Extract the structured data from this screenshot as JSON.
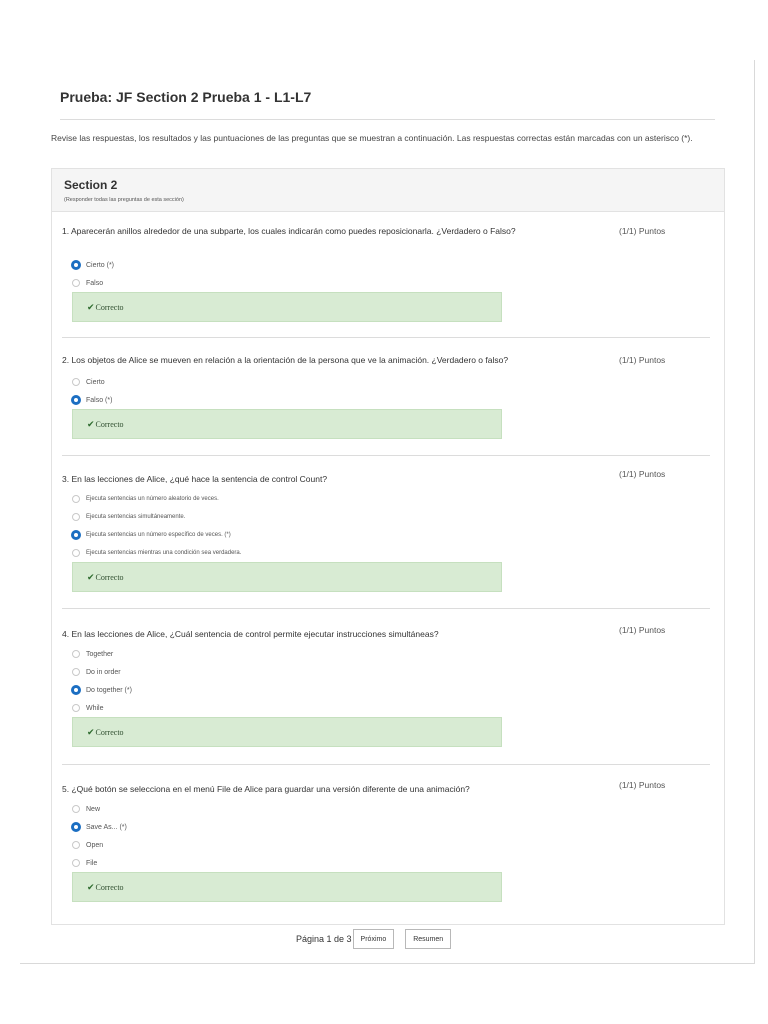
{
  "quiz": {
    "title": "Prueba: JF Section 2 Prueba 1 - L1-L7",
    "intro": "Revise las respuestas, los resultados y las puntuaciones de las preguntas que se muestran a continuación. Las respuestas correctas están marcadas con un asterisco (*)."
  },
  "section": {
    "title": "Section 2",
    "subtitle": "(Responder todas las preguntas de esta sección)"
  },
  "questions": [
    {
      "text": "1. Aparecerán anillos alrededor de una subparte, los cuales indicarán como puedes reposicionarla. ¿Verdadero o Falso?",
      "points": "(1/1) Puntos",
      "options": [
        {
          "label": "Cierto (*)",
          "selected": true
        },
        {
          "label": "Falso",
          "selected": false
        }
      ],
      "feedback": "Correcto"
    },
    {
      "text": "2. Los objetos de Alice se mueven en relación a la orientación de la persona que ve la animación. ¿Verdadero o falso?",
      "points": "(1/1) Puntos",
      "options": [
        {
          "label": "Cierto",
          "selected": false
        },
        {
          "label": "Falso (*)",
          "selected": true
        }
      ],
      "feedback": "Correcto"
    },
    {
      "text": "3. En las lecciones de Alice, ¿qué hace la sentencia de control Count?",
      "points": "(1/1) Puntos",
      "options": [
        {
          "label": "Ejecuta sentencias un número aleatorio de veces.",
          "selected": false
        },
        {
          "label": "Ejecuta sentencias simultáneamente.",
          "selected": false
        },
        {
          "label": "Ejecuta sentencias un número específico de veces. (*)",
          "selected": true
        },
        {
          "label": "Ejecuta sentencias mientras una condición sea verdadera.",
          "selected": false
        }
      ],
      "feedback": "Correcto"
    },
    {
      "text": "4. En las lecciones de Alice, ¿Cuál sentencia de control permite ejecutar instrucciones simultáneas?",
      "points": "(1/1) Puntos",
      "options": [
        {
          "label": "Together",
          "selected": false
        },
        {
          "label": "Do in order",
          "selected": false
        },
        {
          "label": "Do together (*)",
          "selected": true
        },
        {
          "label": "While",
          "selected": false
        }
      ],
      "feedback": "Correcto"
    },
    {
      "text": "5. ¿Qué botón se selecciona en el menú File de Alice para guardar una versión diferente de una animación?",
      "points": "(1/1) Puntos",
      "options": [
        {
          "label": "New",
          "selected": false
        },
        {
          "label": "Save As... (*)",
          "selected": true
        },
        {
          "label": "Open",
          "selected": false
        },
        {
          "label": "File",
          "selected": false
        }
      ],
      "feedback": "Correcto"
    }
  ],
  "pagination": {
    "page_text": "Página 1 de 3",
    "next_label": "Próximo",
    "summary_label": "Resumen"
  },
  "icons": {
    "radio_selected": "radio-selected-icon",
    "radio_unselected": "radio-unselected-icon",
    "feedback": "checkmark-icon"
  },
  "colors": {
    "radio_selected": "#1b6ec2",
    "feedback_background": "#d8ebd3",
    "feedback_check": "#2e6b2e"
  }
}
